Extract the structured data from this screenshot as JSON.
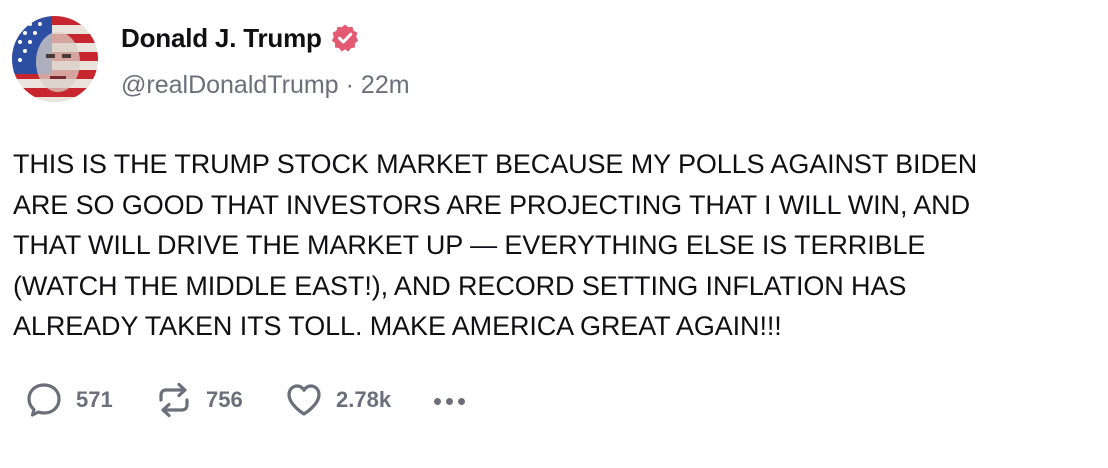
{
  "author": {
    "display_name": "Donald J. Trump",
    "handle": "@realDonaldTrump",
    "separator": "·",
    "time_ago": "22m",
    "verified": true,
    "avatar_icon": "profile-avatar-flag-portrait"
  },
  "post": {
    "text": "THIS IS THE TRUMP STOCK MARKET BECAUSE MY POLLS AGAINST BIDEN\nARE SO GOOD THAT INVESTORS ARE PROJECTING THAT I WILL WIN, AND\nTHAT WILL DRIVE THE MARKET UP — EVERYTHING ELSE IS TERRIBLE\n(WATCH THE MIDDLE EAST!), AND RECORD SETTING INFLATION HAS\nALREADY TAKEN ITS TOLL. MAKE AMERICA GREAT AGAIN!!!"
  },
  "actions": {
    "replies": "571",
    "reposts": "756",
    "likes": "2.78k",
    "icons": [
      "reply-icon",
      "repost-icon",
      "heart-icon",
      "more-icon"
    ]
  },
  "colors": {
    "verified_badge": "#e45a72",
    "muted_text": "#6b6f7a",
    "text": "#0f0f14"
  }
}
